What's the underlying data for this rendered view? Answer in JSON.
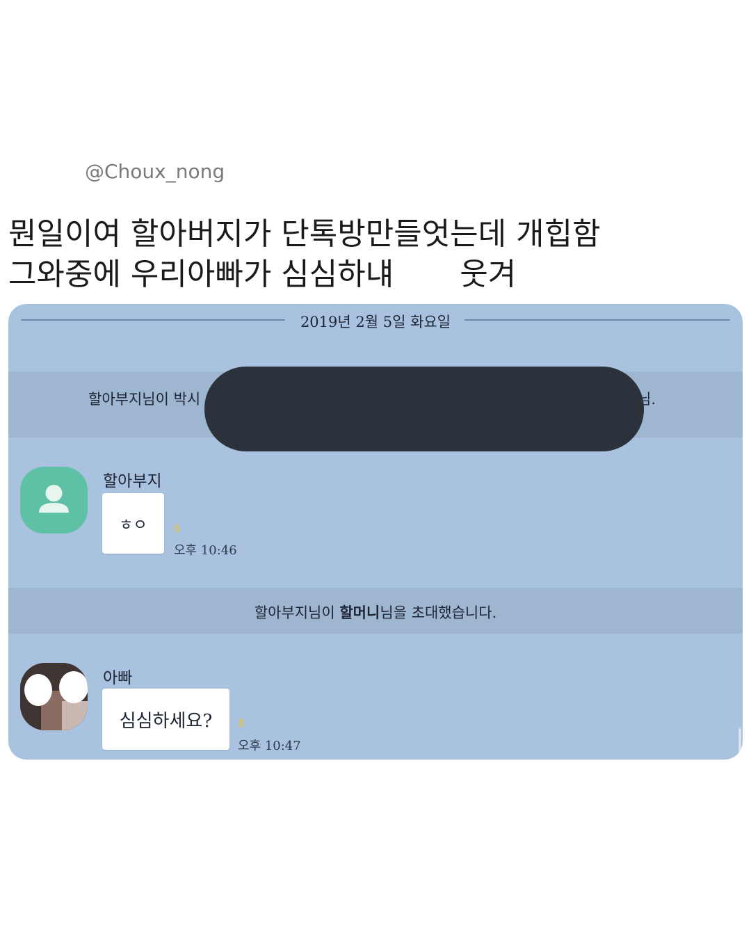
{
  "post": {
    "handle": "@Choux_nong",
    "caption_line1": "뭔일이여 할아버지가 단톡방만들엇는데 개힙함",
    "caption_line2": "그와중에 우리아빠가 심심하냬",
    "caption_line2_tail": "웃겨"
  },
  "chat": {
    "date": "2019년 2월 5일 화요일",
    "system1_prefix": "할아부지님이 박시",
    "system1_suffix": "님.",
    "messages": [
      {
        "sender": "할아부지",
        "text": "ㅎㅇ",
        "unread": "6",
        "time": "오후 10:46",
        "avatar_icon": "person-icon"
      },
      {
        "sender": "아빠",
        "text": "심심하세요?",
        "unread": "8",
        "time": "오후 10:47",
        "avatar_icon": "profile-photo"
      }
    ],
    "system2_prefix": "할아부지님이 ",
    "system2_bold": "할머니",
    "system2_suffix": "님을 초대했습니다."
  }
}
